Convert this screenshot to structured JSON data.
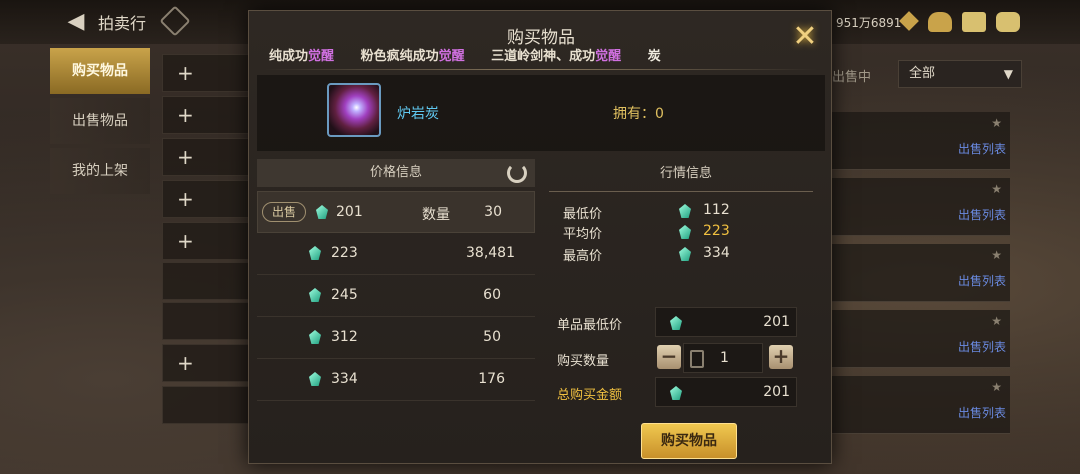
{
  "topbar": {
    "title": "拍卖行",
    "currency": "951万6891"
  },
  "side_tabs": [
    "购买物品",
    "出售物品",
    "我的上架"
  ],
  "filter": {
    "label": "出售中",
    "selected": "全部"
  },
  "right_list": {
    "link_label": "出售列表"
  },
  "modal": {
    "title": "购买物品",
    "marquee": [
      {
        "text": "纯成功",
        "highlight": "觉醒"
      },
      {
        "text": "粉色疯纯成功",
        "highlight": "觉醒"
      },
      {
        "text": "三道岭剑神、成功",
        "highlight": "觉醒"
      },
      {
        "text": "炭",
        "highlight": ""
      }
    ],
    "item": {
      "name": "炉岩炭",
      "owned_label": "拥有",
      "owned_value": "0"
    },
    "price_info": {
      "header": "价格信息",
      "sell_tag": "出售",
      "qty_label": "数量",
      "rows": [
        {
          "price": "201",
          "qty": "30"
        },
        {
          "price": "223",
          "qty": "38,481"
        },
        {
          "price": "245",
          "qty": "60"
        },
        {
          "price": "312",
          "qty": "50"
        },
        {
          "price": "334",
          "qty": "176"
        }
      ]
    },
    "market_info": {
      "header": "行情信息",
      "lowest_label": "最低价",
      "lowest_value": "112",
      "average_label": "平均价",
      "average_value": "223",
      "highest_label": "最高价",
      "highest_value": "334"
    },
    "form": {
      "unit_min_label": "单品最低价",
      "unit_min_value": "201",
      "buy_qty_label": "购买数量",
      "buy_qty_value": "1",
      "total_label": "总购买金额",
      "total_value": "201"
    },
    "buy_button": "购买物品"
  }
}
